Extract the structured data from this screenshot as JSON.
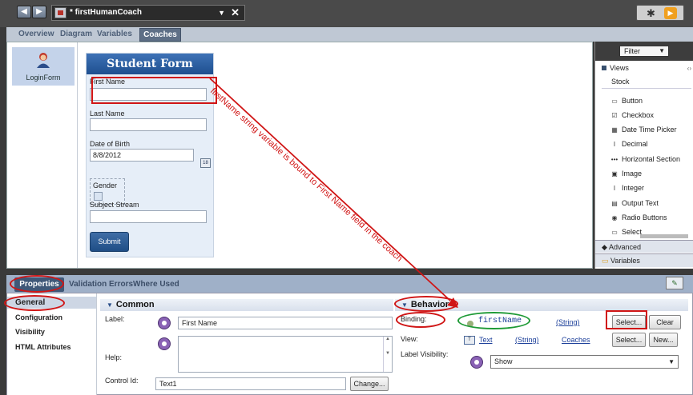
{
  "window": {
    "title": "* firstHumanCoach",
    "back_glyph": "◀",
    "forward_glyph": "▶",
    "dropdown_glyph": "▼",
    "close_glyph": "✕",
    "debug_glyph": "✱",
    "run_glyph": "▶"
  },
  "tabs": [
    "Overview",
    "Diagram",
    "Variables",
    "Coaches"
  ],
  "active_tab": "Coaches",
  "left_pane": {
    "item_label": "LoginForm"
  },
  "form": {
    "title": "Student Form",
    "first_name_label": "First Name",
    "first_name_value": "",
    "last_name_label": "Last Name",
    "last_name_value": "",
    "dob_label": "Date of Birth",
    "dob_value": "8/8/2012",
    "gender_label": "Gender",
    "subject_label": "Subject Stream",
    "subject_value": "",
    "submit_label": "Submit",
    "calendar_icon_text": "18"
  },
  "annotation": {
    "text": "firstName string variable is bound to First Name field in the coach",
    "color": "#d01515",
    "binding_ellipse_color": "#1e9a36"
  },
  "palette": {
    "filter_label": "Filter",
    "views_label": "Views",
    "stock_label": "Stock",
    "items": [
      {
        "label": "Button",
        "icon": "button-icon",
        "glyph": "▭"
      },
      {
        "label": "Checkbox",
        "icon": "checkbox-icon",
        "glyph": "☑"
      },
      {
        "label": "Date Time Picker",
        "icon": "calendar-icon",
        "glyph": "▦"
      },
      {
        "label": "Decimal",
        "icon": "decimal-icon",
        "glyph": "I"
      },
      {
        "label": "Horizontal Section",
        "icon": "horizontal-section-icon",
        "glyph": "•••"
      },
      {
        "label": "Image",
        "icon": "image-icon",
        "glyph": "▣"
      },
      {
        "label": "Integer",
        "icon": "integer-icon",
        "glyph": "I"
      },
      {
        "label": "Output Text",
        "icon": "document-icon",
        "glyph": "▤"
      },
      {
        "label": "Radio Buttons",
        "icon": "radio-icon",
        "glyph": "◉"
      },
      {
        "label": "Select",
        "icon": "select-icon",
        "glyph": "▭"
      }
    ],
    "advanced_label": "Advanced",
    "variables_label": "Variables"
  },
  "bottom_tabs": [
    "Properties",
    "Validation Errors",
    "Where Used"
  ],
  "properties_nav": [
    "General",
    "Configuration",
    "Visibility",
    "HTML Attributes"
  ],
  "common": {
    "header": "Common",
    "label_label": "Label:",
    "label_value": "First Name",
    "help_label": "Help:",
    "help_value": "",
    "control_id_label": "Control Id:",
    "control_id_value": "Text1",
    "change_button": "Change..."
  },
  "behavior": {
    "header": "Behavior",
    "binding_label": "Binding:",
    "binding_value": "firstName",
    "binding_type": "(String)",
    "select_button": "Select...",
    "clear_button": "Clear",
    "view_label": "View:",
    "view_value": "Text",
    "view_type": "(String)",
    "view_source": "Coaches",
    "view_select_button": "Select...",
    "view_new_button": "New...",
    "label_visibility_label": "Label Visibility:",
    "label_visibility_value": "Show"
  }
}
